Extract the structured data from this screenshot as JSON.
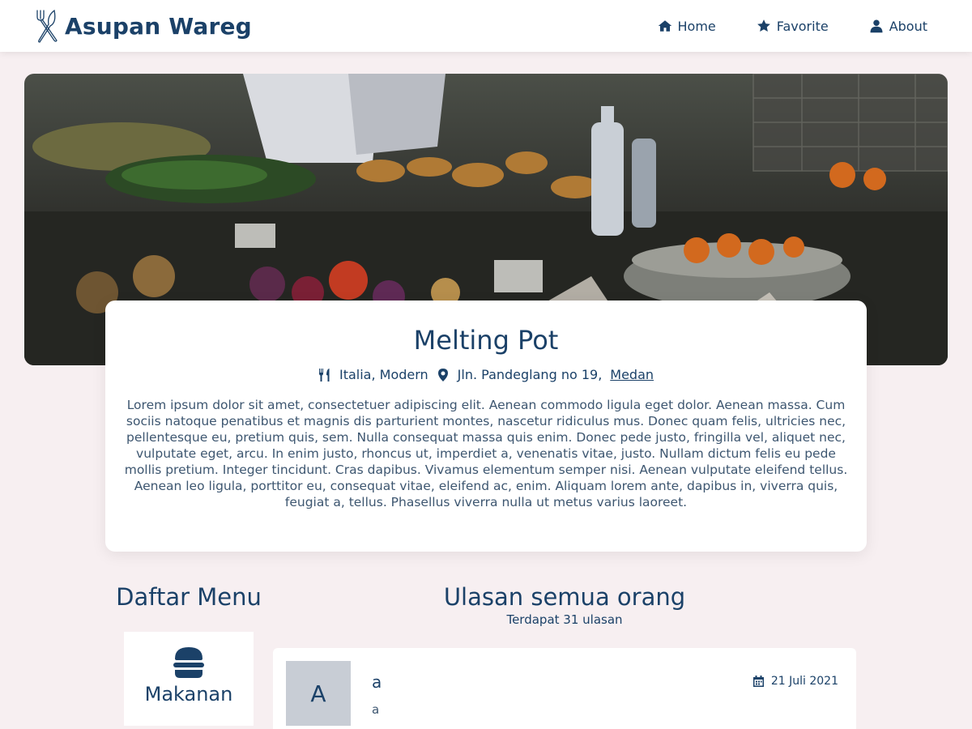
{
  "brand": {
    "name": "Asupan Wareg"
  },
  "nav": [
    {
      "label": "Home",
      "icon": "home-icon"
    },
    {
      "label": "Favorite",
      "icon": "star-icon"
    },
    {
      "label": "About",
      "icon": "user-icon"
    }
  ],
  "restaurant": {
    "name": "Melting Pot",
    "categories": "Italia, Modern",
    "address": "Jln. Pandeglang no 19,",
    "city": "Medan",
    "description": "Lorem ipsum dolor sit amet, consectetuer adipiscing elit. Aenean commodo ligula eget dolor. Aenean massa. Cum sociis natoque penatibus et magnis dis parturient montes, nascetur ridiculus mus. Donec quam felis, ultricies nec, pellentesque eu, pretium quis, sem. Nulla consequat massa quis enim. Donec pede justo, fringilla vel, aliquet nec, vulputate eget, arcu. In enim justo, rhoncus ut, imperdiet a, venenatis vitae, justo. Nullam dictum felis eu pede mollis pretium. Integer tincidunt. Cras dapibus. Vivamus elementum semper nisi. Aenean vulputate eleifend tellus. Aenean leo ligula, porttitor eu, consequat vitae, eleifend ac, enim. Aliquam lorem ante, dapibus in, viverra quis, feugiat a, tellus. Phasellus viverra nulla ut metus varius laoreet."
  },
  "menu": {
    "title": "Daftar Menu",
    "items": [
      {
        "label": "Makanan",
        "icon": "burger-icon"
      }
    ]
  },
  "reviews": {
    "title": "Ulasan semua orang",
    "count_text": "Terdapat 31 ulasan",
    "items": [
      {
        "avatar": "A",
        "name": "a",
        "text": "a",
        "date": "21 Juli 2021"
      }
    ]
  },
  "colors": {
    "primary": "#1b4168",
    "background": "#f7eff1",
    "card": "#ffffff",
    "avatar_bg": "#c8cdd5"
  }
}
